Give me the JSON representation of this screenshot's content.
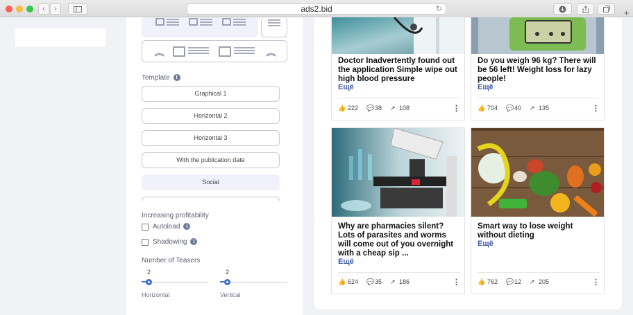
{
  "browser": {
    "url": "ads2.bid",
    "back": "‹",
    "forward": "›",
    "reload": "↻"
  },
  "settings": {
    "template_label": "Template",
    "templates": [
      "Graphical 1",
      "Horizontal 2",
      "Horizontal 3",
      "With the publication date",
      "Social"
    ],
    "profit_label": "Increasing profitability",
    "autoload": "Autoload",
    "shadowing": "Shadowing",
    "teasers_label": "Number of Teasers",
    "horizontal_value": "2",
    "vertical_value": "2",
    "horizontal_label": "Horizontal",
    "vertical_label": "Vertical"
  },
  "cards": [
    {
      "title": "Doctor Inadvertently found out the application Simple wipe out high blood pressure",
      "more": "Ещё",
      "likes": "222",
      "comments": "38",
      "shares": "108"
    },
    {
      "title": "Do you weigh 96 kg? There will be 56 left! Weight loss for lazy people!",
      "more": "Ещё",
      "likes": "704",
      "comments": "40",
      "shares": "135"
    },
    {
      "title": "Why are pharmacies silent? Lots of parasites and worms will come out of you overnight with a cheap sip ...",
      "more": "Ещё",
      "likes": "624",
      "comments": "35",
      "shares": "186"
    },
    {
      "title": "Smart way to lose weight without dieting",
      "more": "Ещё",
      "likes": "762",
      "comments": "12",
      "shares": "205"
    }
  ]
}
